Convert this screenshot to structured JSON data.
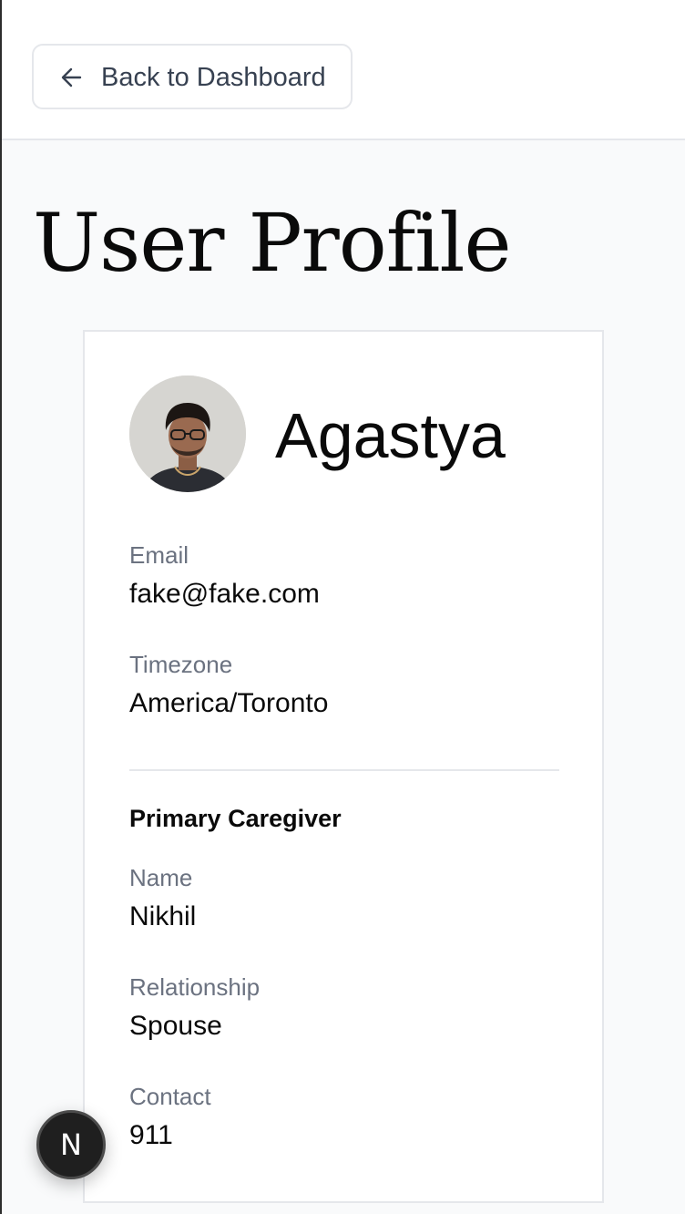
{
  "header": {
    "back_label": "Back to Dashboard"
  },
  "page": {
    "title": "User Profile"
  },
  "profile": {
    "name": "Agastya",
    "fields": {
      "email_label": "Email",
      "email_value": "fake@fake.com",
      "timezone_label": "Timezone",
      "timezone_value": "America/Toronto"
    }
  },
  "caregiver": {
    "heading": "Primary Caregiver",
    "name_label": "Name",
    "name_value": "Nikhil",
    "relationship_label": "Relationship",
    "relationship_value": "Spouse",
    "contact_label": "Contact",
    "contact_value": "911"
  },
  "badge": {
    "letter": "N"
  },
  "icons": {
    "back": "arrow-left-icon"
  },
  "colors": {
    "page_background": "#f9fafb",
    "border": "#e5e7eb",
    "label_text": "#6b7280",
    "primary_text": "#0a0a0a",
    "badge_background": "#1f1f1f"
  }
}
